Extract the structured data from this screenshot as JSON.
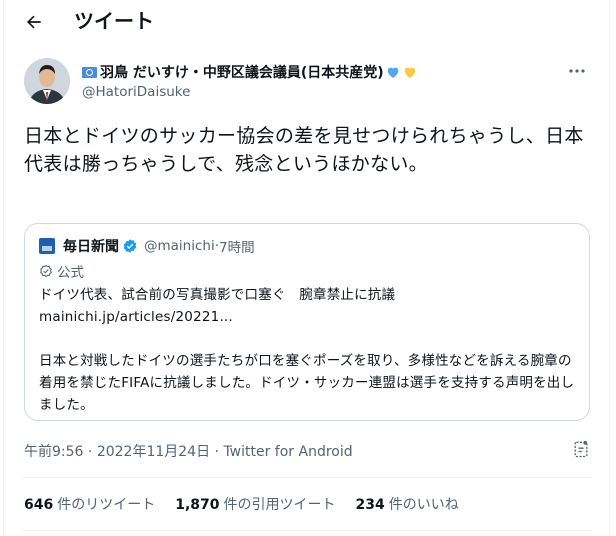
{
  "header": {
    "title": "ツイート"
  },
  "author": {
    "display_name": "羽鳥 だいすけ・中野区議会議員(日本共産党)",
    "handle": "@HatoriDaisuke"
  },
  "tweet": {
    "text": "日本とドイツのサッカー協会の差を見せつけられちゃうし、日本代表は勝っちゃうしで、残念というほかない。"
  },
  "quote": {
    "name": "毎日新聞",
    "handle": "@mainichi",
    "separator": "·",
    "time": "7時間",
    "official_label": "公式",
    "body": "ドイツ代表、試合前の写真撮影で口塞ぐ　腕章禁止に抗議\nmainichi.jp/articles/20221...\n\n日本と対戦したドイツの選手たちが口を塞ぐポーズを取り、多様性などを訴える腕章の着用を禁じたFIFAに抗議しました。ドイツ・サッカー連盟は選手を支持する声明を出しました。"
  },
  "meta": {
    "time": "午前9:56",
    "date": "2022年11月24日",
    "separator": "·",
    "source": "Twitter for Android"
  },
  "stats": {
    "retweets_count": "646",
    "retweets_label": "件のリツイート",
    "quotes_count": "1,870",
    "quotes_label": "件の引用ツイート",
    "likes_count": "234",
    "likes_label": "件のいいね"
  },
  "icons": {
    "back": "back-arrow-icon",
    "more": "more-dots-icon",
    "verified": "verified-badge-icon",
    "official": "official-check-icon",
    "share": "share-icon",
    "un_flag": "un-flag-icon",
    "blue_heart": "blue-heart-icon",
    "yellow_heart": "yellow-heart-icon"
  },
  "colors": {
    "text": "#0f1419",
    "secondary": "#536471",
    "border": "#cfd9de",
    "verified": "#1d9bf0",
    "blue_heart": "#4fa8ef",
    "yellow_heart": "#f7c948"
  }
}
